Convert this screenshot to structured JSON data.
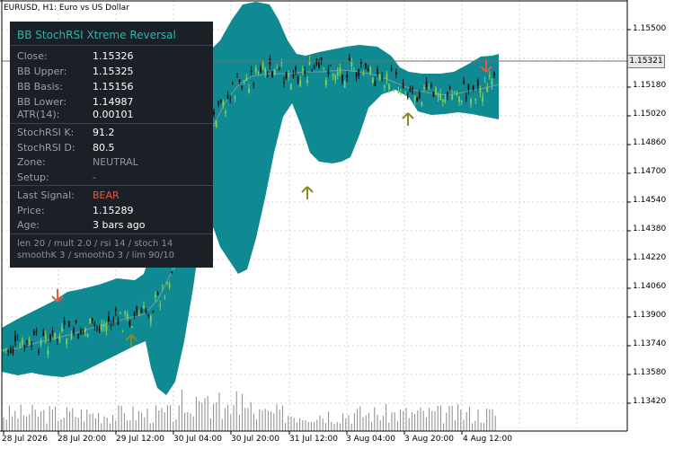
{
  "window": {
    "title": "EURUSD, H1:  Euro vs US Dollar"
  },
  "panel": {
    "title": "BB StochRSI Xtreme Reversal",
    "rows": [
      {
        "label": "Close:",
        "value": "1.15326"
      },
      {
        "label": "BB Upper:",
        "value": "1.15325"
      },
      {
        "label": "BB Basis:",
        "value": "1.15156"
      },
      {
        "label": "BB Lower:",
        "value": "1.14987"
      },
      {
        "label": "ATR(14):",
        "value": "0.00101"
      },
      {
        "label": "StochRSI K:",
        "value": "91.2"
      },
      {
        "label": "StochRSI D:",
        "value": "80.5"
      },
      {
        "label": "Zone:",
        "value": "NEUTRAL"
      },
      {
        "label": "Setup:",
        "value": "-"
      },
      {
        "label": "Last Signal:",
        "value": "BEAR"
      },
      {
        "label": "Price:",
        "value": "1.15289"
      },
      {
        "label": "Age:",
        "value": "3 bars ago"
      }
    ],
    "footer_line1": "len 20 / mult 2.0 / rsi 14 / stoch 14",
    "footer_line2": "smoothK 3 / smoothD 3 / lim 90/10",
    "signal_color": "#e05a4a",
    "title_color": "#35b2a8"
  },
  "price_axis": {
    "labels": [
      "1.15500",
      "1.15340",
      "1.15180",
      "1.15020",
      "1.14860",
      "1.14700",
      "1.14540",
      "1.14380",
      "1.14220",
      "1.14060",
      "1.13900",
      "1.13740",
      "1.13580",
      "1.13420"
    ],
    "current_price": "1.15321"
  },
  "time_axis": {
    "labels": [
      "28 Jul 2026",
      "28 Jul 20:00",
      "29 Jul 12:00",
      "30 Jul 04:00",
      "30 Jul 20:00",
      "31 Jul 12:00",
      "3 Aug 04:00",
      "3 Aug 20:00",
      "4 Aug 12:00"
    ]
  },
  "colors": {
    "band": "#108a92",
    "bull": "#7fd05a",
    "bear": "#111111",
    "basis": "#7a9aa0",
    "up_arrow": "#8a8a1e",
    "down_arrow": "#e05a4a"
  }
}
